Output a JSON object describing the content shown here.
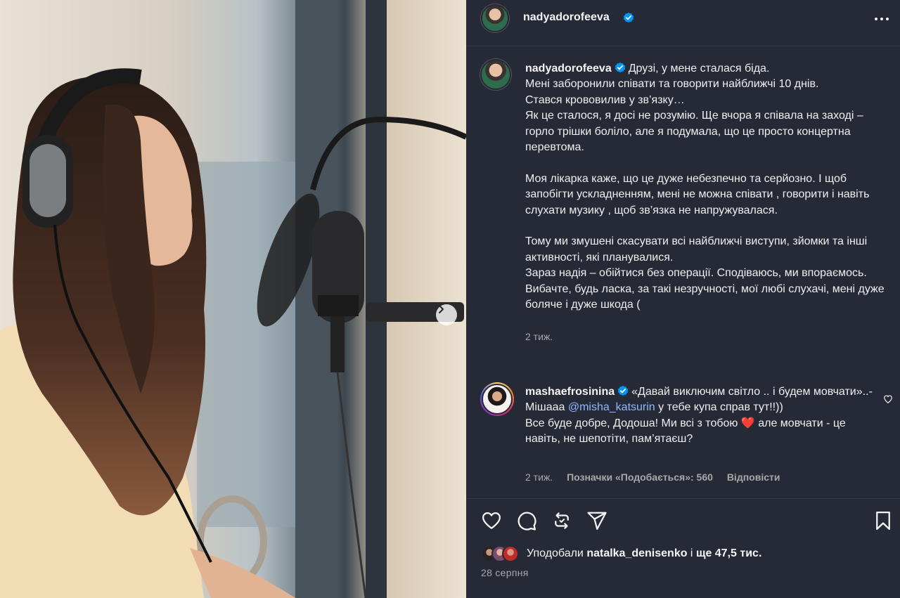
{
  "header": {
    "username": "nadyadorofeeva"
  },
  "post": {
    "username": "nadyadorofeeva",
    "caption": "Друзі, у мене сталася біда.\nМені заборонили співати та говорити найближчі 10 днів.\nСтався крововилив у зв’язку…\nЯк це сталося, я досі не розумію. Ще вчора я співала на заході – горло трішки боліло, але я подумала, що це просто концертна перевтома.\n\nМоя лікарка каже, що це дуже небезпечно та серйозно. І щоб запобігти ускладненням, мені не можна співати , говорити і навіть слухати музику , щоб зв’язка не напружувалася.\n\nТому ми змушені скасувати всі найближчі виступи, зйомки та інші активності, які планувалися.\nЗараз надія – обійтися без операції. Сподіваюсь, ми впораємось.\nВибачте, будь ласка, за такі незручності, мої любі слухачі, мені дуже боляче і дуже шкода (",
    "time": "2 тиж."
  },
  "comment": {
    "username": "mashaefrosinina",
    "text_part1": "«Давай виключим світло .. і будем мовчати»..- Мішааа ",
    "mention": "@misha_katsurin",
    "text_part2": " у тебе купа справ тут!!))\nВсе буде добре, Додоша! Ми всі з тобою ",
    "heart": "❤️",
    "text_part3": " але мовчати - це навіть, не шепотіти, пам’ятаєш?",
    "time": "2 тиж.",
    "likes": "Позначки «Подобається»: 560",
    "reply": "Відповісти"
  },
  "footer": {
    "liked_prefix": "Уподобали ",
    "liked_user": "natalka_denisenko",
    "liked_middle": " і ",
    "liked_count": "ще 47,5 тис.",
    "date": "28 серпня"
  },
  "icons": [
    "verified-icon",
    "more-icon",
    "chevron-right-icon",
    "heart-icon",
    "comment-icon",
    "repost-icon",
    "share-icon",
    "bookmark-icon"
  ],
  "colors": {
    "panel_bg": "#262a36",
    "verified": "#0095f6",
    "mention": "#8fb8ff",
    "heart": "#ed4956"
  }
}
